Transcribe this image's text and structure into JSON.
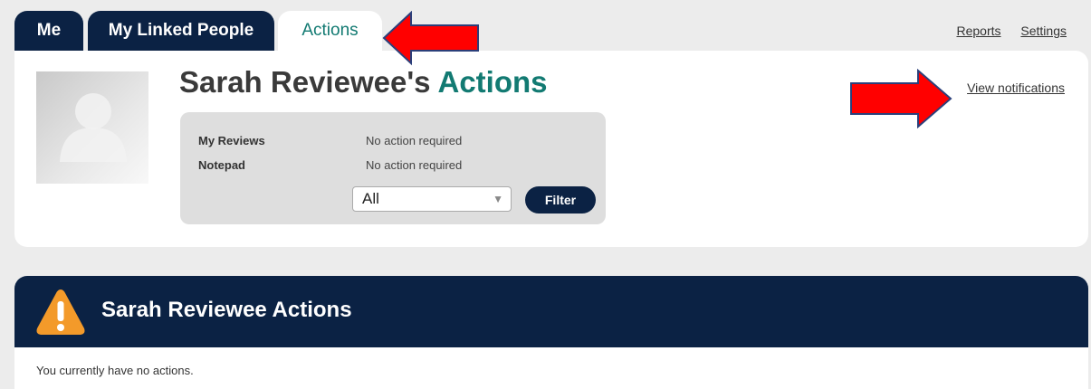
{
  "tabs": [
    {
      "label": "Me"
    },
    {
      "label": "My Linked People"
    },
    {
      "label": "Actions"
    }
  ],
  "top_links": {
    "reports": "Reports",
    "settings": "Settings"
  },
  "header": {
    "title_name": "Sarah Reviewee's",
    "title_accent": "Actions",
    "view_notifications": "View notifications"
  },
  "summary": {
    "rows": [
      {
        "label": "My Reviews",
        "value": "No action required"
      },
      {
        "label": "Notepad",
        "value": "No action required"
      }
    ],
    "filter_select_value": "All",
    "filter_button": "Filter"
  },
  "actions_section": {
    "title": "Sarah Reviewee Actions",
    "empty_message": "You currently have no actions."
  },
  "colors": {
    "navy": "#0b2244",
    "accent_teal": "#127a72",
    "warning_orange": "#f39a2a",
    "annotation_red": "#ff0000"
  }
}
